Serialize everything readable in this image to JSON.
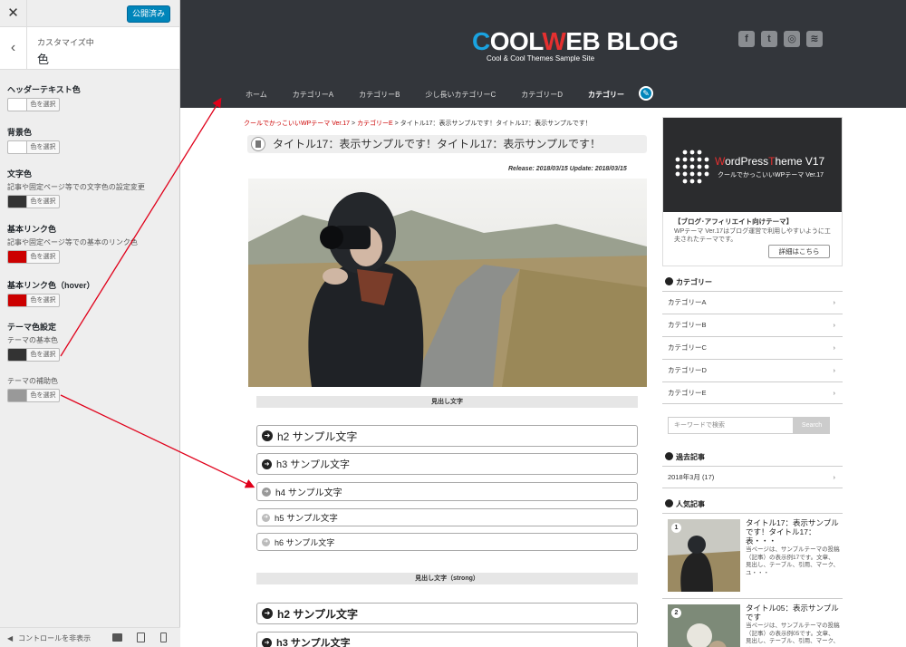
{
  "customizer": {
    "close_icon": "close-icon",
    "publish_label": "公開済み",
    "section_crumb": "カスタマイズ中",
    "section_title": "色",
    "controls": [
      {
        "title": "ヘッダーテキスト色",
        "desc": "",
        "swatch": "#ffffff",
        "button": "色を選択"
      },
      {
        "title": "背景色",
        "desc": "",
        "swatch": "#ffffff",
        "button": "色を選択"
      },
      {
        "title": "文字色",
        "desc": "記事や固定ページ等での文字色の設定変更",
        "swatch": "#333333",
        "button": "色を選択"
      },
      {
        "title": "基本リンク色",
        "desc": "記事や固定ページ等での基本のリンク色",
        "swatch": "#cc0000",
        "button": "色を選択"
      },
      {
        "title": "基本リンク色（hover）",
        "desc": "",
        "swatch": "#cc0000",
        "button": "色を選択"
      },
      {
        "title": "テーマ色設定",
        "desc": "テーマの基本色",
        "swatch": "#333333",
        "button": "色を選択"
      },
      {
        "title": "",
        "desc": "テーマの補助色",
        "swatch": "#999999",
        "button": "色を選択"
      }
    ],
    "hide_controls_label": "コントロールを非表示"
  },
  "site": {
    "logo_c": "C",
    "logo_ool": "OOL",
    "logo_w": "W",
    "logo_rest": "EB BLOG",
    "tagline": "Cool & Cool Themes Sample Site",
    "socials": [
      "f",
      "t",
      "◎",
      "≋"
    ],
    "nav": [
      "ホーム",
      "カテゴリーA",
      "カテゴリーB",
      "少し長いカテゴリーC",
      "カテゴリーD",
      "カテゴリー"
    ],
    "accent": "#c00000"
  },
  "post": {
    "breadcrumb_home": "クールでかっこいいWPテーマ Ver.17",
    "breadcrumb_sep1": " > ",
    "breadcrumb_cat": "カテゴリーE",
    "breadcrumb_sep2": " > ",
    "breadcrumb_current": "タイトル17：表示サンプルです！タイトル17：表示サンプルです！",
    "title": "タイトル17：表示サンプルです！タイトル17：表示サンプルです！",
    "dates": "Release: 2018/03/15 Update: 2018/03/15",
    "headings_label": "見出し文字",
    "headings": [
      "h2 サンプル文字",
      "h3 サンプル文字",
      "h4 サンプル文字",
      "h5 サンプル文字",
      "h6 サンプル文字"
    ],
    "headings_strong_label": "見出し文字（strong）",
    "headings_strong": [
      "h2 サンプル文字",
      "h3 サンプル文字"
    ]
  },
  "sidebar": {
    "banner_brand_w": "W",
    "banner_brand_mid": "ordPress",
    "banner_brand_t": "T",
    "banner_brand_end": "heme V17",
    "banner_sub": "クールでかっこいいWPテーマ Ver.17",
    "banner_head": "【ブログ･アフィリエイト向けテーマ】",
    "banner_desc": "WPテーマ Ver.17はブログ運営で利用しやすいように工夫されたテーマです。",
    "banner_more": "詳細はこちら",
    "categories_title": "カテゴリー",
    "categories": [
      "カテゴリーA",
      "カテゴリーB",
      "カテゴリーC",
      "カテゴリーD",
      "カテゴリーE"
    ],
    "search_placeholder": "キーワードで検索",
    "search_button": "Search",
    "archive_title": "過去記事",
    "archive_item": "2018年3月 (17)",
    "popular_title": "人気記事",
    "popular": [
      {
        "rank": "1",
        "title": "タイトル17：表示サンプルです！タイトル17：表・・・",
        "desc": "当ページは、サンプルテーマの投稿（記事）の表示例17です。文章、見出し、テーブル、引用、マーク、ユ・・・"
      },
      {
        "rank": "2",
        "title": "タイトル05：表示サンプルです",
        "desc": "当ページは、サンプルテーマの投稿（記事）の表示例05です。文章、見出し、テーブル、引用、マーク、ユ・・・"
      }
    ]
  }
}
